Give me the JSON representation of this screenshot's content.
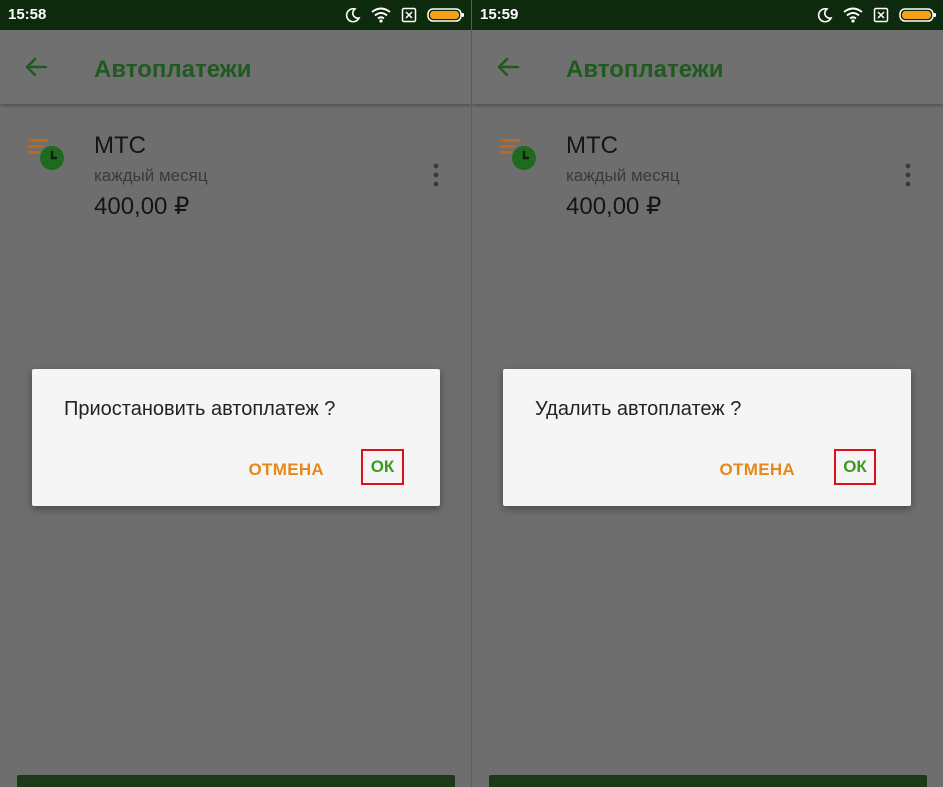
{
  "screens": [
    {
      "status_time": "15:58",
      "title": "Автоплатежи",
      "item": {
        "name": "МТС",
        "frequency": "каждый месяц",
        "amount": "400,00 ₽"
      },
      "dialog": {
        "message": "Приостановить автоплатеж ?",
        "cancel_label": "ОТМЕНА",
        "ok_label": "ОК"
      }
    },
    {
      "status_time": "15:59",
      "title": "Автоплатежи",
      "item": {
        "name": "МТС",
        "frequency": "каждый месяц",
        "amount": "400,00 ₽"
      },
      "dialog": {
        "message": "Удалить автоплатеж ?",
        "cancel_label": "ОТМЕНА",
        "ok_label": "ОК"
      }
    }
  ],
  "icons": [
    "moon-icon",
    "wifi-icon",
    "sim-blocked-icon",
    "battery-icon",
    "back-arrow-icon",
    "autopay-clock-icon",
    "more-vert-icon"
  ],
  "colors": {
    "title_green": "#1f5a1f",
    "status_bar": "#0d2a0d",
    "cancel_orange": "#e5891c",
    "ok_green": "#3c9a1e",
    "highlight_red": "#e0101a",
    "battery_orange": "#f5a21a"
  }
}
